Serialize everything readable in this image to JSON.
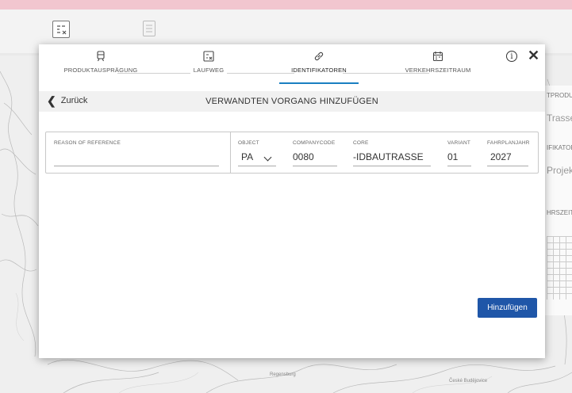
{
  "steps": [
    {
      "label": "PRODUKTAUSPRÄGUNG",
      "icon": "train-icon"
    },
    {
      "label": "LAUFWEG",
      "icon": "route-map-icon"
    },
    {
      "label": "IDENTIFIKATOREN",
      "icon": "link-icon"
    },
    {
      "label": "VERKEHRSZEITRAUM",
      "icon": "calendar-icon"
    }
  ],
  "active_step": "IDENTIFIKATOREN",
  "header": {
    "info_icon": "info-icon",
    "close_icon": "close-icon"
  },
  "subbar": {
    "back_label": "Zurück",
    "title": "VERWANDTEN VORGANG HINZUFÜGEN"
  },
  "form": {
    "reason": {
      "label": "REASON OF REFERENCE",
      "value": ""
    },
    "object": {
      "label": "OBJECT",
      "value": "PA"
    },
    "companycode": {
      "label": "COMPANYCODE",
      "value": "0080"
    },
    "core": {
      "label": "CORE",
      "value": "-IDBAUTRASSE"
    },
    "variant": {
      "label": "VARIANT",
      "value": "01"
    },
    "fahrplanjahr": {
      "label": "FAHRPLANJAHR",
      "value": "2027"
    }
  },
  "submit_label": "Hinzufügen",
  "background": {
    "right_panel": [
      "TPRODU",
      "Trasse",
      "IFIKATOR",
      "Projek",
      "HRSZEIT"
    ],
    "map_labels": [
      "Regensburg",
      "České Budějovice"
    ]
  },
  "colors": {
    "accent": "#1a7fc1",
    "button": "#1f56a8",
    "pink_bar": "#f2c6cf"
  }
}
